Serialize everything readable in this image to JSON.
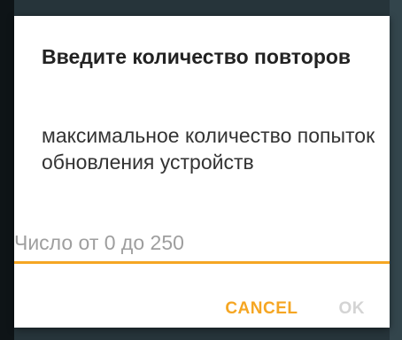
{
  "dialog": {
    "title": "Введите количество повторов",
    "message": "максимальное количество попыток обновления устройств",
    "input": {
      "value": "",
      "placeholder": "Число от 0 до 250"
    },
    "buttons": {
      "cancel": "CANCEL",
      "ok": "OK"
    }
  },
  "colors": {
    "accent": "#f5a623",
    "disabled": "#d4d4d4",
    "placeholder": "#9e9e9e"
  }
}
